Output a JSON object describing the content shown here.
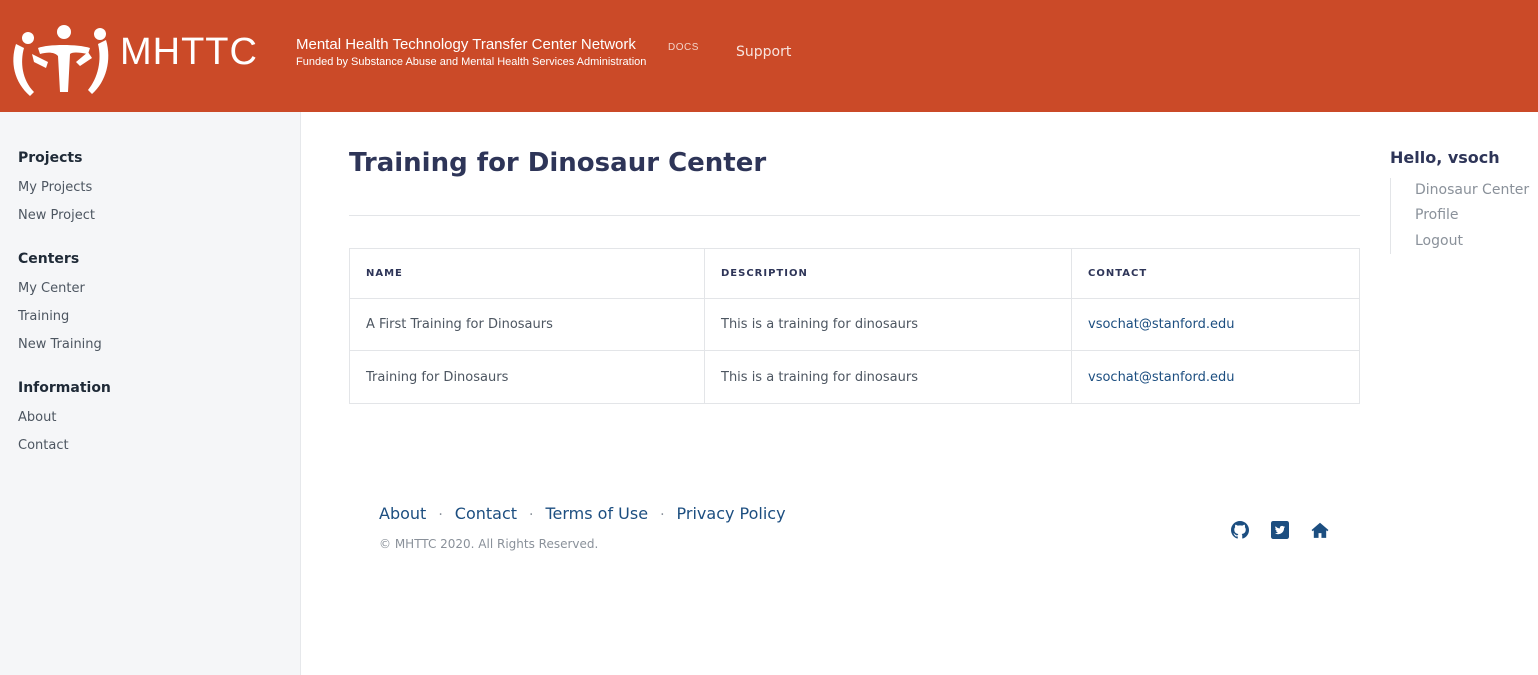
{
  "header": {
    "brand": "MHTTC",
    "network_title": "Mental Health Technology Transfer Center Network",
    "docs": "DOCS",
    "funded_by": "Funded by Substance Abuse and Mental Health Services Administration",
    "support": "Support",
    "colors": {
      "background": "#cb4a28",
      "text": "#ffffff"
    }
  },
  "sidebar": {
    "groups": [
      {
        "title": "Projects",
        "items": [
          "My Projects",
          "New Project"
        ]
      },
      {
        "title": "Centers",
        "items": [
          "My Center",
          "Training",
          "New Training"
        ]
      },
      {
        "title": "Information",
        "items": [
          "About",
          "Contact"
        ]
      }
    ]
  },
  "main": {
    "title": "Training for Dinosaur Center",
    "table": {
      "headers": [
        "NAME",
        "DESCRIPTION",
        "CONTACT"
      ],
      "rows": [
        {
          "name": "A First Training for Dinosaurs",
          "description": "This is a training for dinosaurs",
          "contact": "vsochat@stanford.edu"
        },
        {
          "name": "Training for Dinosaurs",
          "description": "This is a training for dinosaurs",
          "contact": "vsochat@stanford.edu"
        }
      ]
    }
  },
  "toc": {
    "greeting": "Hello, vsoch",
    "links": [
      "Dinosaur Center",
      "Profile",
      "Logout"
    ]
  },
  "footer": {
    "links": [
      "About",
      "Contact",
      "Terms of Use",
      "Privacy Policy"
    ],
    "separator": "·",
    "copyright": "© MHTTC 2020. All Rights Reserved.",
    "social_icons": [
      "github-icon",
      "twitter-icon",
      "home-icon"
    ],
    "link_color": "#1c4e80"
  }
}
